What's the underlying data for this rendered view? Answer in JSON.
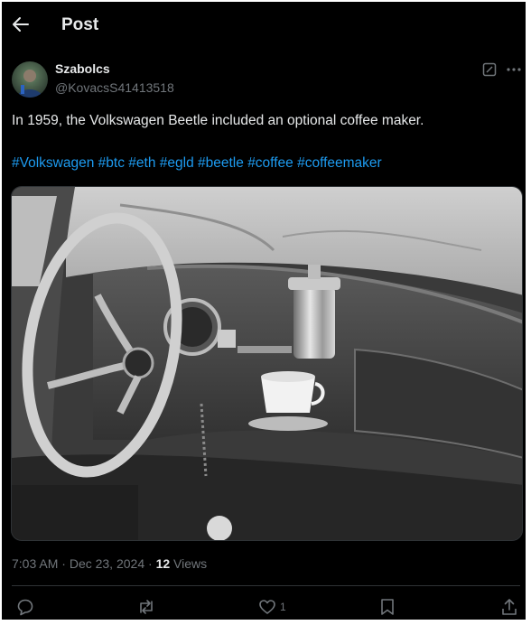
{
  "header": {
    "title": "Post",
    "back_icon": "arrow-left-icon"
  },
  "post": {
    "author_name": "Szabolcs",
    "author_handle": "@KovacsS41413518",
    "text": "In 1959, the Volkswagen Beetle included an optional coffee maker.",
    "hashtags": [
      "#Volkswagen",
      "#btc",
      "#eth",
      "#egld",
      "#beetle",
      "#coffee",
      "#coffeemaker"
    ],
    "time": "7:03 AM",
    "date": "Dec 23, 2024",
    "dot": "·",
    "views_count": "12",
    "views_label": "Views"
  },
  "actions": {
    "reply_icon": "reply-icon",
    "repost_icon": "repost-icon",
    "like_icon": "heart-icon",
    "like_count": "1",
    "bookmark_icon": "bookmark-icon",
    "share_icon": "share-icon"
  },
  "colors": {
    "background": "#000000",
    "text": "#e7e9ea",
    "muted": "#71767b",
    "link": "#1d9bf0",
    "divider": "#2f3336"
  }
}
